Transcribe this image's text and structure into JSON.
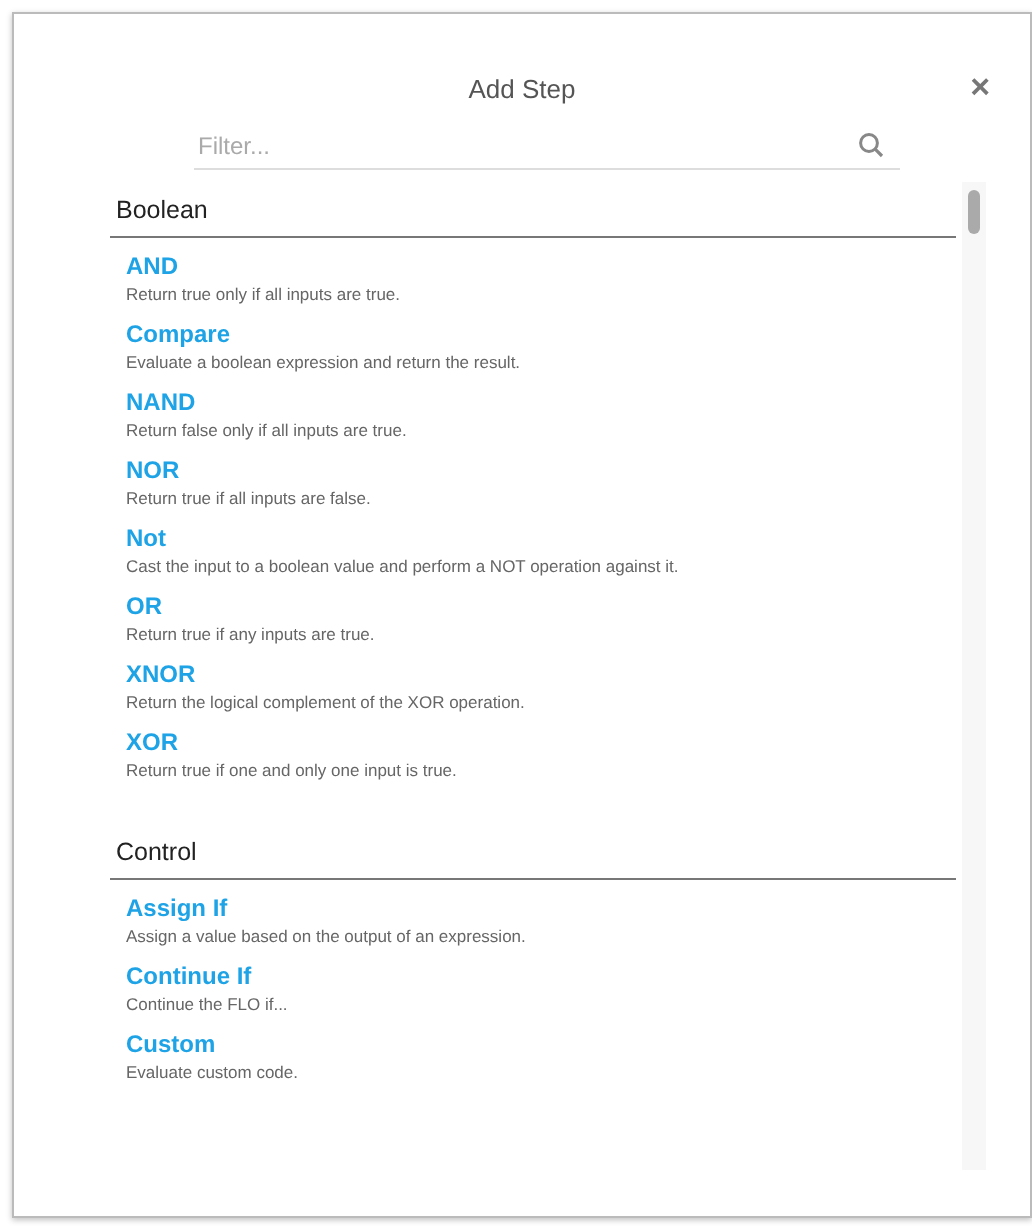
{
  "dialog": {
    "title": "Add Step",
    "close": "×"
  },
  "filter": {
    "placeholder": "Filter..."
  },
  "sections": [
    {
      "title": "Boolean",
      "steps": [
        {
          "name": "AND",
          "description": "Return true only if all inputs are true."
        },
        {
          "name": "Compare",
          "description": "Evaluate a boolean expression and return the result."
        },
        {
          "name": "NAND",
          "description": "Return false only if all inputs are true."
        },
        {
          "name": "NOR",
          "description": "Return true if all inputs are false."
        },
        {
          "name": "Not",
          "description": "Cast the input to a boolean value and perform a NOT operation against it."
        },
        {
          "name": "OR",
          "description": "Return true if any inputs are true."
        },
        {
          "name": "XNOR",
          "description": "Return the logical complement of the XOR operation."
        },
        {
          "name": "XOR",
          "description": "Return true if one and only one input is true."
        }
      ]
    },
    {
      "title": "Control",
      "steps": [
        {
          "name": "Assign If",
          "description": "Assign a value based on the output of an expression."
        },
        {
          "name": "Continue If",
          "description": "Continue the FLO if..."
        },
        {
          "name": "Custom",
          "description": "Evaluate custom code."
        }
      ]
    }
  ]
}
